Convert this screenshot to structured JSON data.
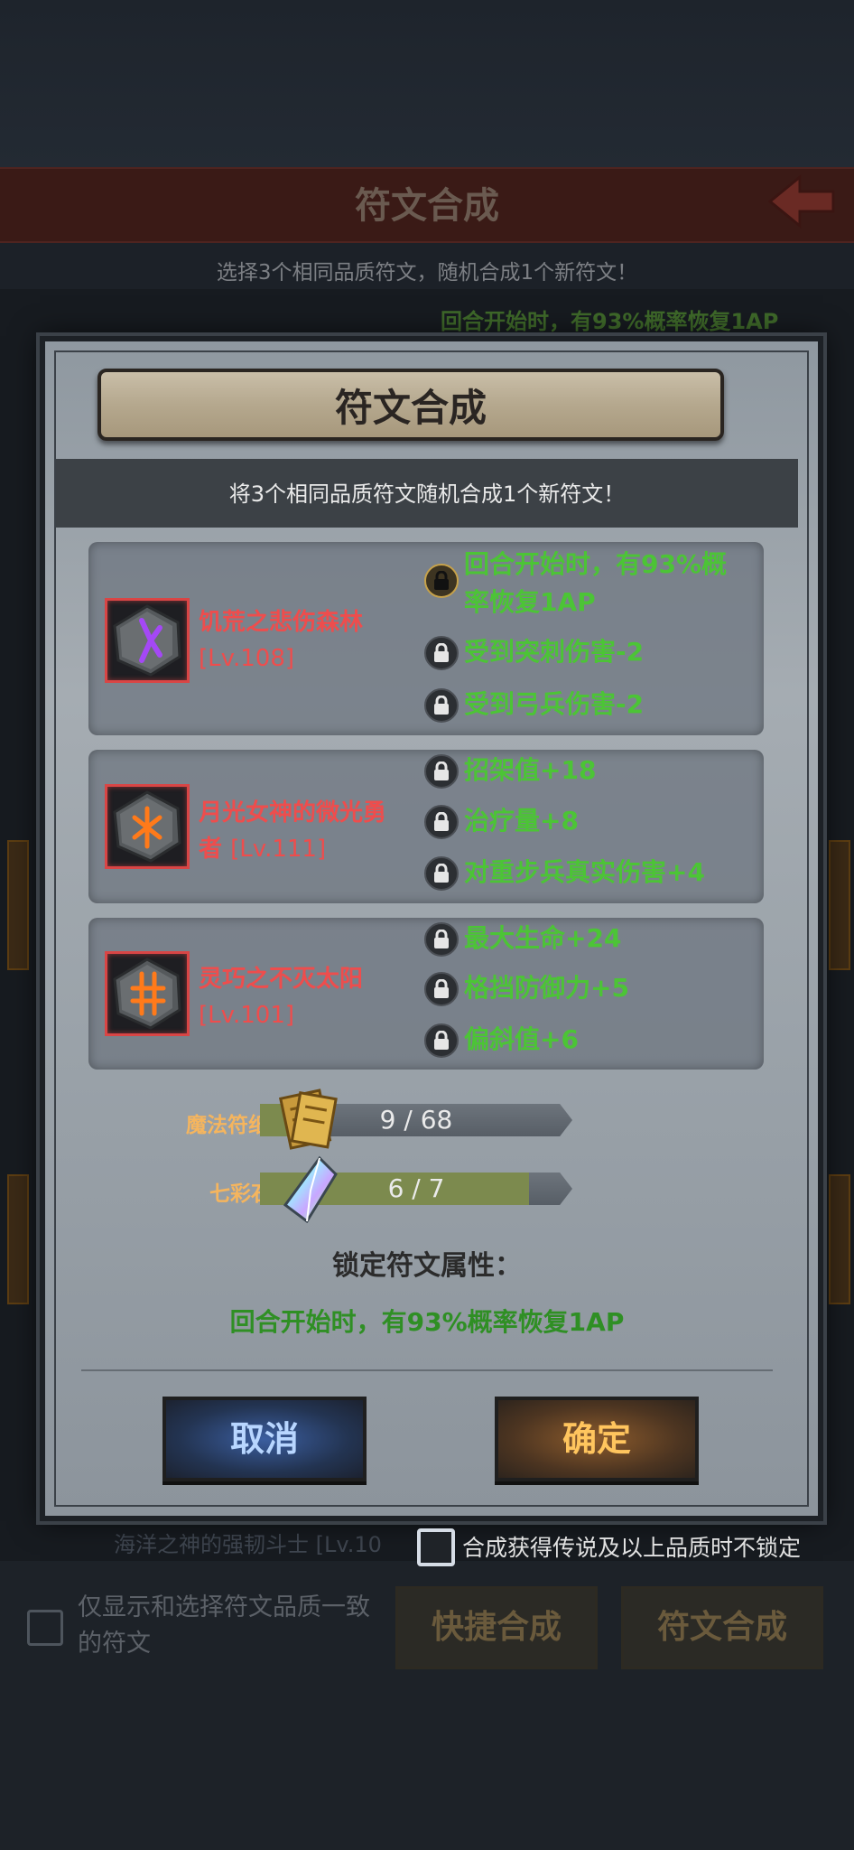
{
  "background_page": {
    "title": "符文合成",
    "subtitle": "选择3个相同品质符文，随机合成1个新符文！",
    "partial_line": "回合开始时，有93%概率恢复1AP",
    "partial_row": "海洋之神的强韧斗士 [Lv.10",
    "filter_label": "仅显示和选择符文品质一致的符文",
    "quick_synth_button": "快捷合成",
    "synth_button": "符文合成"
  },
  "dialog": {
    "title": "符文合成",
    "description": "将3个相同品质符文随机合成1个新符文！",
    "runes": [
      {
        "name": "饥荒之悲伤森林",
        "level": "[Lv.108]",
        "glyph_color": "#a448f5",
        "attributes": [
          {
            "text": "回合开始时，有93%概",
            "locked": true
          },
          {
            "text": "率恢复1AP",
            "locked": true
          },
          {
            "text": "受到突刺伤害-2",
            "locked": false
          },
          {
            "text": "受到弓兵伤害-2",
            "locked": false
          }
        ]
      },
      {
        "name": "月光女神的微光勇",
        "name_line2": "者",
        "level": "[Lv.111]",
        "glyph_color": "#ff7a1a",
        "attributes": [
          {
            "text": "招架值+18",
            "locked": false
          },
          {
            "text": "治疗量+8",
            "locked": false
          },
          {
            "text": "对重步兵真实伤害+4",
            "locked": false
          }
        ]
      },
      {
        "name": "灵巧之不灭太阳",
        "level": "[Lv.101]",
        "glyph_color": "#ff7a1a",
        "attributes": [
          {
            "text": "最大生命+24",
            "locked": false
          },
          {
            "text": "格挡防御力+5",
            "locked": false
          },
          {
            "text": "偏斜值+6",
            "locked": false
          }
        ]
      }
    ],
    "materials": [
      {
        "label": "魔法符纸",
        "count": "9 / 68",
        "fill": 0.13,
        "icon": "paper-scroll-icon"
      },
      {
        "label": "七彩石",
        "count": "6 / 7",
        "fill": 0.86,
        "icon": "rainbow-crystal-icon"
      }
    ],
    "locked_title": "锁定符文属性：",
    "locked_attribute": "回合开始时，有93%概率恢复1AP",
    "cancel_label": "取消",
    "confirm_label": "确定",
    "no_lock_checkbox_label": "合成获得传说及以上品质时不锁定",
    "no_lock_checked": false
  }
}
